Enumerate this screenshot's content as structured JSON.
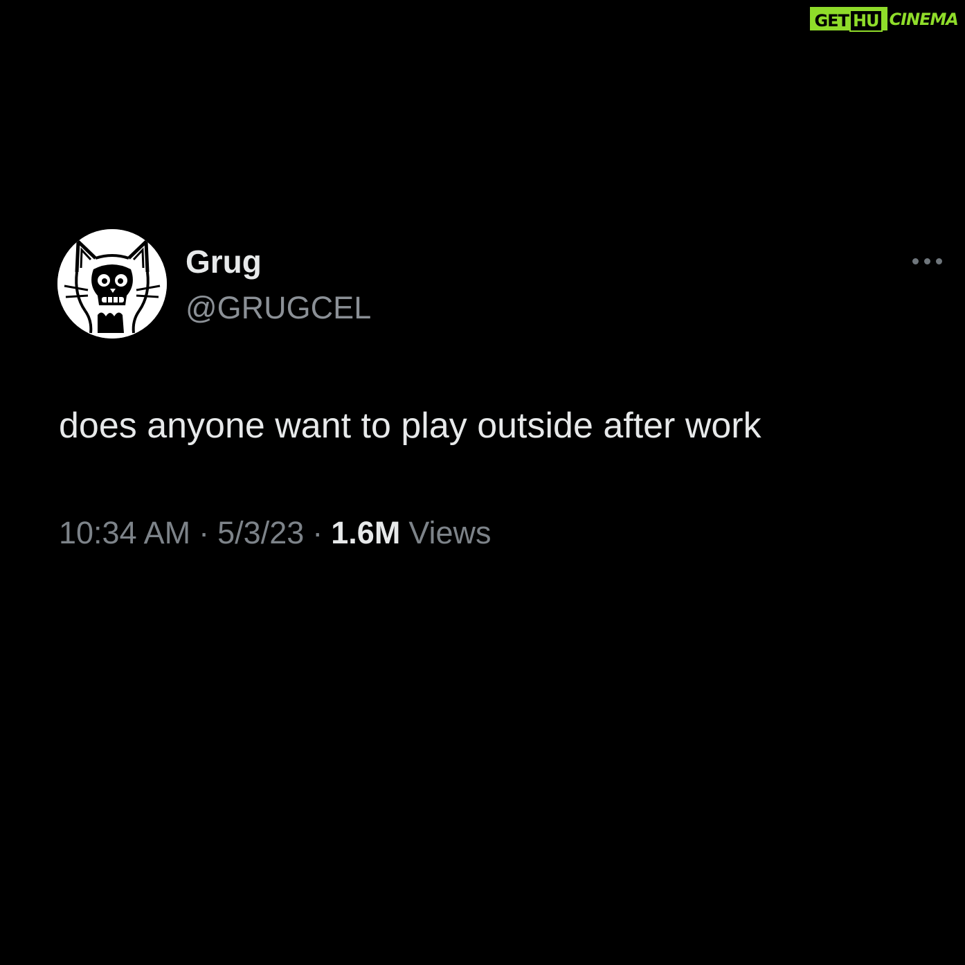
{
  "watermark": {
    "part1": "GETHU",
    "part2": "CINEMA",
    "accent_color": "#8fdc2a"
  },
  "tweet": {
    "author": {
      "display_name": "Grug",
      "handle": "@GRUGCEL",
      "avatar_icon": "cat-skull-avatar"
    },
    "more_icon": "more-horizontal-icon",
    "text": "does anyone want to play outside after work",
    "meta": {
      "time": "10:34 AM",
      "separator": "·",
      "date": "5/3/23",
      "views_count": "1.6M",
      "views_label": "Views"
    }
  }
}
